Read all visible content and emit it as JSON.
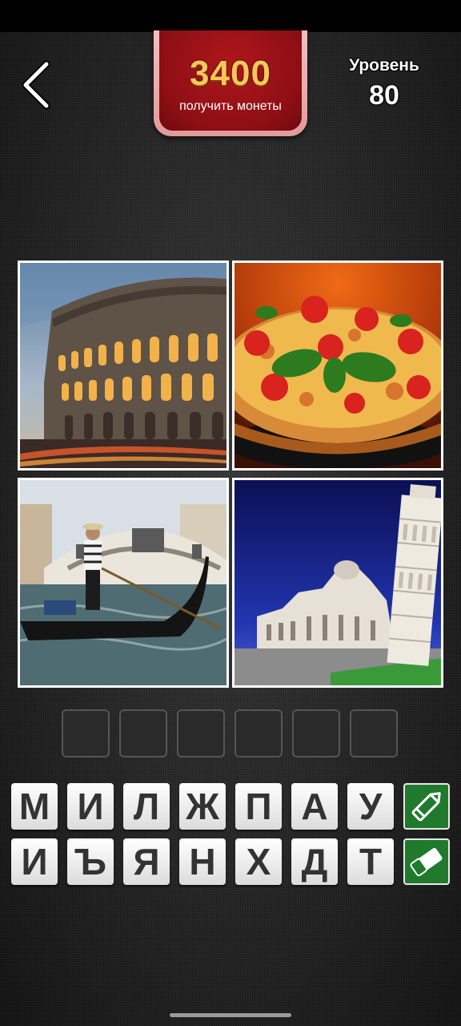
{
  "header": {
    "back_icon": "chevron-left-icon",
    "coins": "3400",
    "coins_caption": "получить монеты",
    "level_label": "Уровень",
    "level_number": "80"
  },
  "puzzle": {
    "images": [
      {
        "subject": "colosseum"
      },
      {
        "subject": "pizza"
      },
      {
        "subject": "venice-gondola"
      },
      {
        "subject": "leaning-tower-of-pisa"
      }
    ],
    "answer_slots": [
      "",
      "",
      "",
      "",
      "",
      ""
    ]
  },
  "keyboard": {
    "row1": [
      "М",
      "И",
      "Л",
      "Ж",
      "П",
      "А",
      "У"
    ],
    "row2": [
      "И",
      "Ъ",
      "Я",
      "Н",
      "Х",
      "Д",
      "Т"
    ],
    "hint_buttons": {
      "row1_icon": "pencil-icon",
      "row2_icon": "eraser-icon"
    }
  },
  "colors": {
    "accent_red": "#8d0f14",
    "coin_gold": "#f4c75a",
    "hint_green": "#1f7a2c"
  }
}
